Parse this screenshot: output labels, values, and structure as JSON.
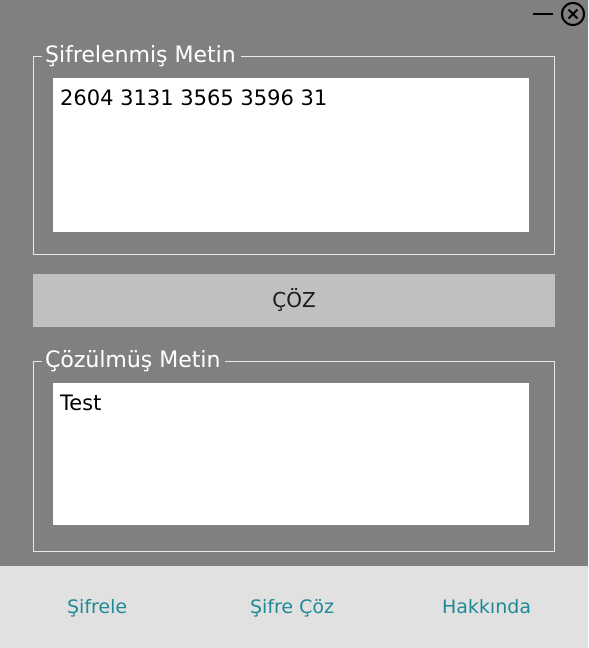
{
  "window": {
    "minimize_icon": "minimize-icon",
    "close_icon": "close-circle-icon"
  },
  "encrypted_group": {
    "legend": "Şifrelenmiş Metin",
    "value": "2604 3131 3565 3596 31"
  },
  "decrypt_button": {
    "label": "ÇÖZ"
  },
  "decrypted_group": {
    "legend": "Çözülmüş  Metin",
    "value": "Test"
  },
  "bottom_nav": {
    "items": [
      {
        "label": "Şifrele"
      },
      {
        "label": "Şifre Çöz"
      },
      {
        "label": "Hakkında"
      }
    ]
  },
  "colors": {
    "window_bg": "#808080",
    "button_bg": "#c0c0c0",
    "nav_bg": "#e1e1e1",
    "nav_text": "#1e8a96"
  }
}
